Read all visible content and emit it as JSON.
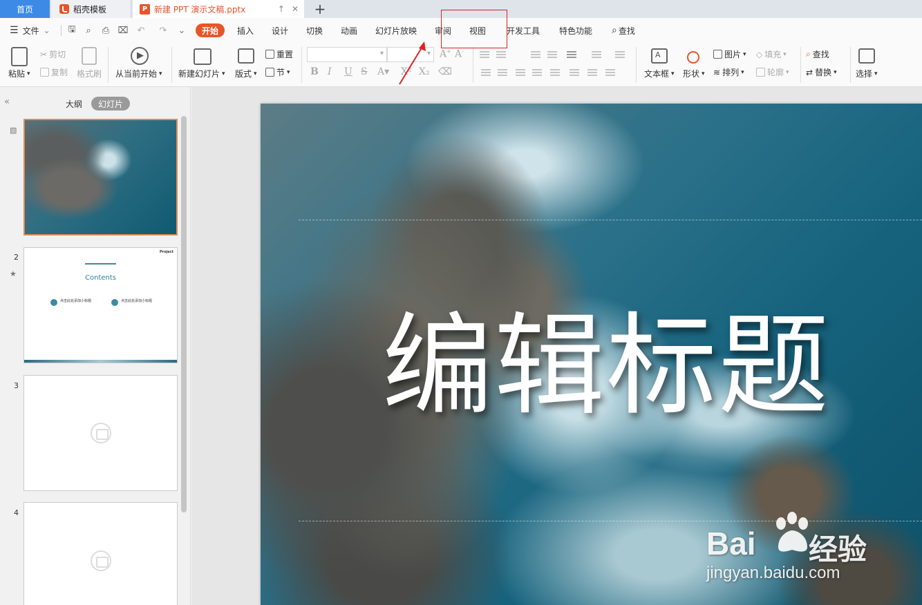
{
  "tabs": {
    "home": "首页",
    "template": "稻壳模板",
    "document": "新建 PPT 演示文稿.pptx",
    "add": "+"
  },
  "menu": {
    "file": "文件",
    "items": [
      "开始",
      "插入",
      "设计",
      "切换",
      "动画",
      "幻灯片放映",
      "审阅",
      "视图",
      "开发工具",
      "特色功能"
    ],
    "active": "开始",
    "search": "查找"
  },
  "ribbon": {
    "paste": "粘贴",
    "cut": "剪切",
    "copy": "复制",
    "format_painter": "格式刷",
    "from_current": "从当前开始",
    "new_slide": "新建幻灯片",
    "layout": "版式",
    "reset": "重置",
    "section": "节",
    "text_box": "文本框",
    "shape": "形状",
    "picture": "图片",
    "fill": "填充",
    "find": "查找",
    "arrange": "排列",
    "outline": "轮廓",
    "replace": "替换",
    "select": "选择"
  },
  "panel": {
    "outline_tab": "大纲",
    "slides_tab": "幻灯片",
    "slides": [
      {
        "number": "",
        "kind": "image"
      },
      {
        "number": "2",
        "kind": "contents"
      },
      {
        "number": "3",
        "kind": "empty"
      },
      {
        "number": "4",
        "kind": "empty"
      }
    ],
    "slide2": {
      "project": "Project",
      "contents": "Contents",
      "item1": "点击此处添加小标题",
      "item2": "点击此处添加小标题"
    }
  },
  "slide": {
    "title": "编辑标题"
  },
  "watermark": {
    "brand": "Bai",
    "cn": "经验",
    "url": "jingyan.baidu.com"
  },
  "colors": {
    "accent": "#e8542a",
    "home_tab": "#3d8ae6",
    "highlight": "#e02020"
  }
}
